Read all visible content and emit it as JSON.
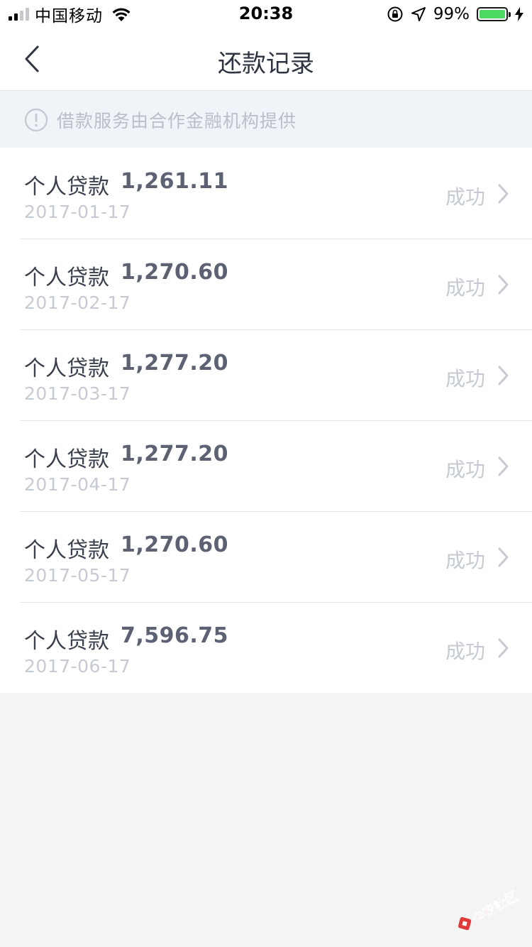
{
  "status_bar": {
    "carrier": "中国移动",
    "time": "20:38",
    "battery_percent": "99%",
    "signal_bars": 4,
    "signal_bars_active": 2
  },
  "nav": {
    "title": "还款记录",
    "back_icon": "chevron-left-icon"
  },
  "notice": {
    "icon": "info-circle-icon",
    "text": "借款服务由合作金融机构提供"
  },
  "records": [
    {
      "name": "个人贷款",
      "amount": "1,261.11",
      "date": "2017-01-17",
      "status": "成功"
    },
    {
      "name": "个人贷款",
      "amount": "1,270.60",
      "date": "2017-02-17",
      "status": "成功"
    },
    {
      "name": "个人贷款",
      "amount": "1,277.20",
      "date": "2017-03-17",
      "status": "成功"
    },
    {
      "name": "个人贷款",
      "amount": "1,277.20",
      "date": "2017-04-17",
      "status": "成功"
    },
    {
      "name": "个人贷款",
      "amount": "1,270.60",
      "date": "2017-05-17",
      "status": "成功"
    },
    {
      "name": "个人贷款",
      "amount": "7,596.75",
      "date": "2017-06-17",
      "status": "成功"
    }
  ],
  "watermark": {
    "text": "卡农社区",
    "color": "#e03a3a"
  },
  "colors": {
    "battery_green": "#4cd964",
    "notice_bg": "#f0f3f7",
    "page_bg": "#f4f4f5"
  }
}
